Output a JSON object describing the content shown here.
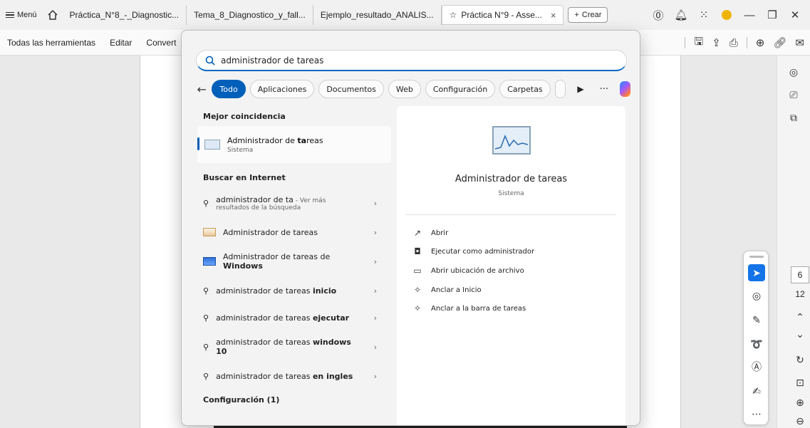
{
  "tabbar": {
    "menu_label": "Menú",
    "tabs": [
      {
        "label": "Práctica_N°8_-_Diagnostic..."
      },
      {
        "label": "Tema_8_Diagnostico_y_fall..."
      },
      {
        "label": "Ejemplo_resultado_ANALIS..."
      },
      {
        "label": "Práctica N°9 - Asse..."
      }
    ],
    "create_label": "Crear"
  },
  "toolbar": {
    "items": [
      "Todas las herramientas",
      "Editar",
      "Convert"
    ]
  },
  "search": {
    "query": "administrador de tareas",
    "filters": [
      "Todo",
      "Aplicaciones",
      "Documentos",
      "Web",
      "Configuración",
      "Carpetas"
    ],
    "best_match_title": "Mejor coincidencia",
    "best_match": {
      "name_plain": "Administrador de ",
      "name_bold": "ta",
      "name_rest": "reas",
      "type": "Sistema"
    },
    "internet_title": "Buscar en Internet",
    "internet_results": [
      {
        "text_plain": "administrador de ta",
        "suffix": " - Ver más",
        "sub": "resultados de la búsqueda"
      },
      {
        "text_plain": "Administrador de tareas"
      },
      {
        "text_plain": "Administrador de tareas de",
        "line2": "Windows"
      },
      {
        "text_plain": "administrador de tareas ",
        "bold": "inicio"
      },
      {
        "text_plain": "administrador de tareas ",
        "bold": "ejecutar"
      },
      {
        "text_plain": "administrador de tareas ",
        "bold": "windows",
        "line2": "10"
      },
      {
        "text_plain": "administrador de tareas ",
        "bold": "en ingles"
      }
    ],
    "config_title": "Configuración (1)",
    "preview": {
      "name": "Administrador de tareas",
      "type": "Sistema",
      "actions": [
        "Abrir",
        "Ejecutar como administrador",
        "Abrir ubicación de archivo",
        "Anclar a Inicio",
        "Anclar a la barra de tareas"
      ]
    }
  },
  "pager": {
    "current": "6",
    "total": "12"
  }
}
